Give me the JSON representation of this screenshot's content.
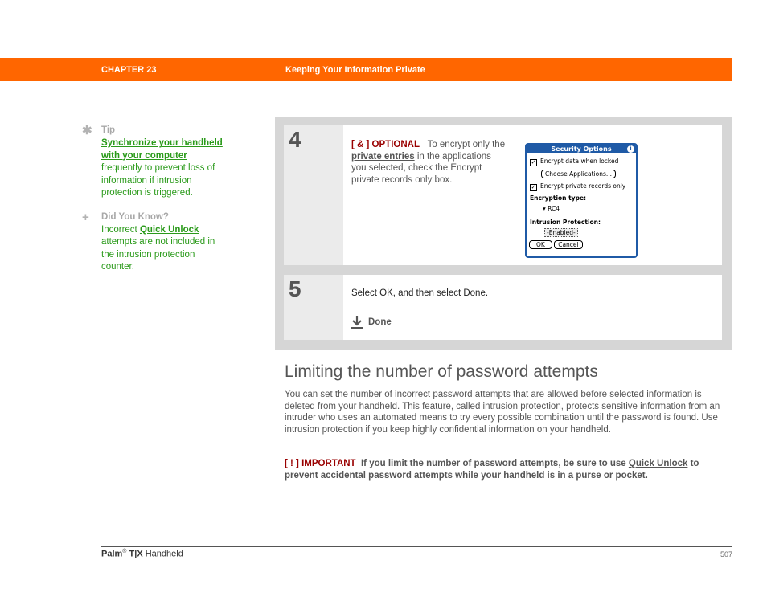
{
  "header": {
    "chapter": "CHAPTER 23",
    "title": "Keeping Your Information Private",
    "bar_color": "#ff6600"
  },
  "sidebar": {
    "tip": {
      "icon": "asterisk-icon",
      "heading": "Tip",
      "link": "Synchronize your handheld with your computer",
      "text": " frequently to prevent loss of information if intrusion protection is triggered."
    },
    "did_you_know": {
      "icon": "plus-icon",
      "heading": "Did You Know?",
      "text_before": "Incorrect ",
      "link": "Quick Unlock",
      "text_after": " attempts are not included in the intrusion protection counter."
    }
  },
  "steps": [
    {
      "number": "4",
      "label": "[ & ]  OPTIONAL",
      "text_before": "To encrypt only the ",
      "link": "private entries",
      "text_after": " in the applications you selected, check the Encrypt private records only box.",
      "screen": {
        "title": "Security Options",
        "info_icon": "i",
        "check1": "Encrypt data when locked",
        "choose_button": "Choose Applications...",
        "check2": "Encrypt private records only",
        "encryption_label": "Encryption type:",
        "encryption_value": "RC4",
        "intrusion_label": "Intrusion Protection:",
        "intrusion_value": "-Enabled-",
        "ok_button": "OK",
        "cancel_button": "Cancel"
      }
    },
    {
      "number": "5",
      "text": "Select OK, and then select Done.",
      "done_label": "Done"
    }
  ],
  "section": {
    "title": "Limiting the number of password attempts",
    "body": "You can set the number of incorrect password attempts that are allowed before selected information is deleted from your handheld. This feature, called intrusion protection, protects sensitive information from an intruder who uses an automated means to try every possible combination until the password is found. Use intrusion protection if you keep highly confidential information on your handheld.",
    "important": {
      "label": "[ ! ] IMPORTANT",
      "text_before": "If you limit the number of password attempts, be sure to use ",
      "link": "Quick Unlock",
      "text_after": " to prevent accidental password attempts while your handheld is in a purse or pocket."
    }
  },
  "footer": {
    "brand": "Palm",
    "reg": "®",
    "model": "T|X",
    "product": " Handheld",
    "page": "507"
  }
}
